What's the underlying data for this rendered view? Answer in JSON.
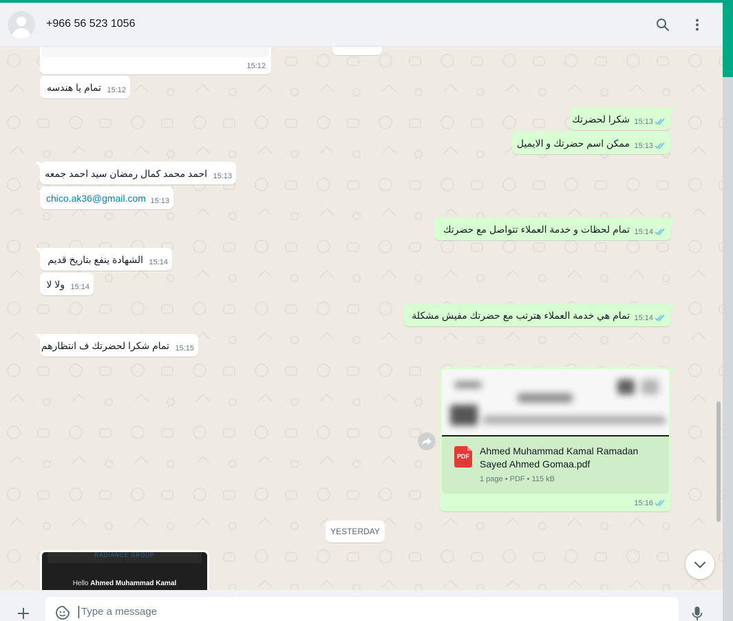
{
  "header": {
    "contact_name": "+966 56 523 1056",
    "search_icon": "search-icon",
    "menu_icon": "kebab-menu-icon"
  },
  "messages": [
    {
      "id": "m1",
      "direction": "in",
      "text": "",
      "time": "15:12"
    },
    {
      "id": "m2",
      "direction": "in",
      "text": "تمام يا هندسه",
      "time": "15:12"
    },
    {
      "id": "m3",
      "direction": "out",
      "text": "شكرا لحضرتك",
      "time": "15:13",
      "status": "read"
    },
    {
      "id": "m4",
      "direction": "out",
      "text": "ممكن اسم حضرتك و الايميل",
      "time": "15:13",
      "status": "read"
    },
    {
      "id": "m5",
      "direction": "in",
      "text": "احمد محمد كمال رمضان سيد احمد جمعه",
      "time": "15:13"
    },
    {
      "id": "m6",
      "direction": "in",
      "text": "chico.ak36@gmail.com",
      "time": "15:13"
    },
    {
      "id": "m7",
      "direction": "out",
      "text": "تمام لحظات و خدمة العملاء تتواصل مع حضرتك",
      "time": "15:14",
      "status": "read"
    },
    {
      "id": "m8",
      "direction": "in",
      "text": "الشهادة ينفع بتاريخ قديم",
      "time": "15:14"
    },
    {
      "id": "m9",
      "direction": "in",
      "text": "ولا لا",
      "time": "15:14"
    },
    {
      "id": "m10",
      "direction": "out",
      "text": "تمام هي خدمة العملاء هترتب مع حضرتك مفيش مشكلة",
      "time": "15:14",
      "status": "read"
    },
    {
      "id": "m11",
      "direction": "in",
      "text": "تمام شكرا لحضرتك ف انتظارهم",
      "time": "15:15"
    }
  ],
  "document_message": {
    "file_name": "Ahmed Muhammad Kamal Ramadan Sayed Ahmed Gomaa.pdf",
    "file_type_badge": "PDF",
    "meta": "1 page • PDF • 115 kB",
    "time": "15:16",
    "status": "read"
  },
  "day_separator": "YESTERDAY",
  "image_message": {
    "logo_text": "RADIANCE GROUP",
    "greeting": "Hello",
    "greeting_name": "Ahmed Muhammad Kamal"
  },
  "composer": {
    "placeholder": "Type a message",
    "attach_icon": "plus-icon",
    "emoji_icon": "sticker-icon",
    "mic_icon": "microphone-icon"
  },
  "colors": {
    "accent": "#00a884",
    "outgoing_bubble": "#d9fdd3",
    "incoming_bubble": "#ffffff",
    "chat_background": "#efeae2",
    "read_ticks": "#53bdeb",
    "link": "#027eb5"
  }
}
